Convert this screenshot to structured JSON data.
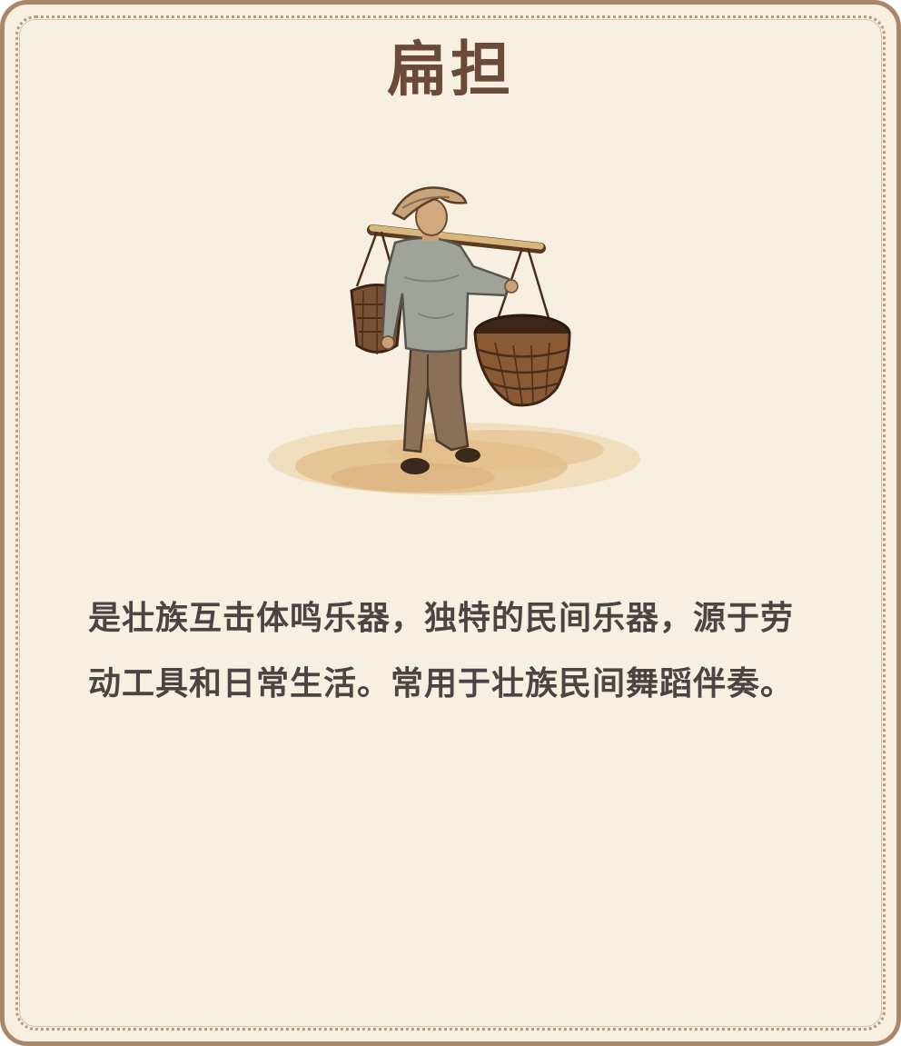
{
  "card": {
    "title": "扁担",
    "description": "是壮族互击体鸣乐器，独特的民间乐器，源于劳动工具和日常生活。常用于壮族民间舞蹈伴奏。"
  },
  "illustration": {
    "subject_icon": "man-carrying-shoulder-pole-baskets-icon"
  },
  "colors": {
    "background": "#f7f0e1",
    "border": "#a9876b",
    "title": "#6b4a3a",
    "text": "#4a4442"
  }
}
